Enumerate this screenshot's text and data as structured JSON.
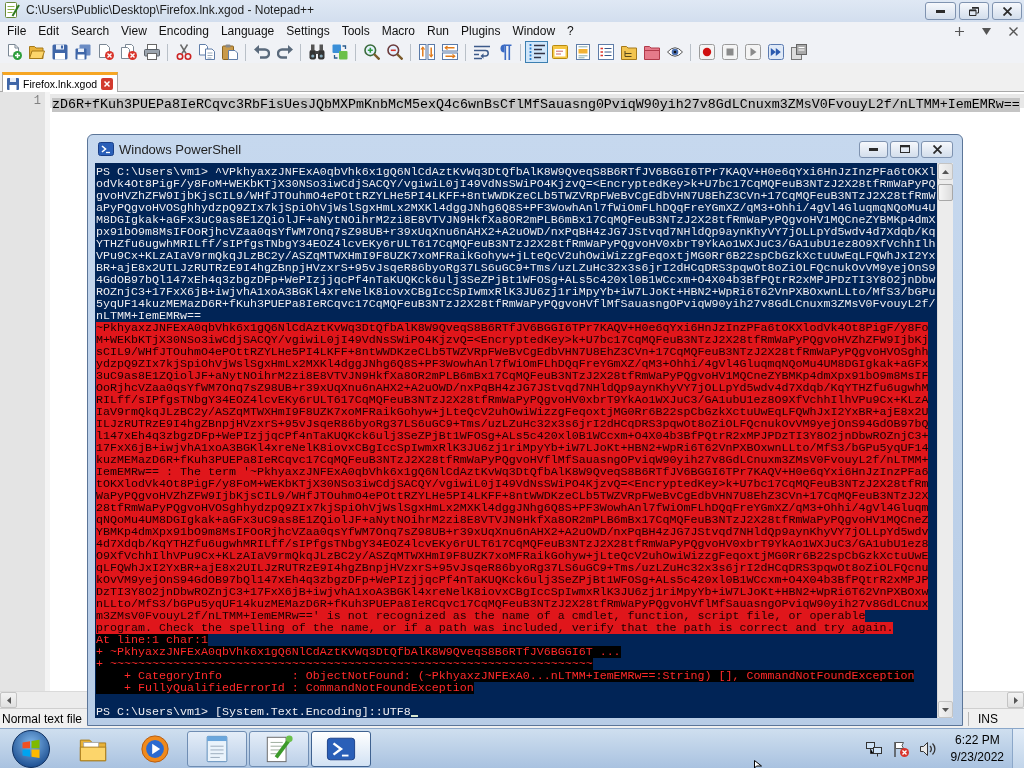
{
  "notepad": {
    "title": "C:\\Users\\Public\\Desktop\\Firefox.lnk.xgod - Notepad++",
    "menu": [
      "File",
      "Edit",
      "Search",
      "View",
      "Encoding",
      "Language",
      "Settings",
      "Tools",
      "Macro",
      "Run",
      "Plugins",
      "Window",
      "?"
    ],
    "toolbar": [
      {
        "pressed": false
      },
      {
        "pressed": false
      },
      {
        "pressed": false
      },
      {
        "pressed": false
      },
      {
        "pressed": false
      },
      {
        "pressed": false
      },
      {
        "pressed": false
      },
      {
        "pressed": false
      },
      {
        "pressed": false
      },
      {
        "pressed": false
      },
      {
        "pressed": false
      },
      {
        "pressed": false
      },
      {
        "pressed": false
      },
      {
        "pressed": false
      },
      {
        "pressed": false
      },
      {
        "pressed": false
      },
      {
        "pressed": false
      },
      {
        "pressed": false
      },
      {
        "pressed": false
      },
      {
        "pressed": false
      },
      {
        "pressed": true
      },
      {
        "pressed": false
      },
      {
        "pressed": false
      },
      {
        "pressed": false
      },
      {
        "pressed": false
      },
      {
        "pressed": false
      },
      {
        "pressed": false
      },
      {
        "pressed": false
      },
      {
        "pressed": false
      },
      {
        "pressed": false
      },
      {
        "pressed": false
      },
      {
        "pressed": false
      }
    ],
    "tabs": [
      {
        "label": "Firefox.lnk.xgod",
        "selected": true
      }
    ],
    "editor": {
      "lines": [
        {
          "number": "1",
          "text": "zD6R+fKuh3PUEPa8IeRCqvc3RbFisUesJQbMXPmKnbMcM5exQ4c6wnBsCflMfSauasng0PviqW90yih27v8GdLCnuxm3ZMsV0FvouyL2f/nLTMM+IemEMRw==",
          "selected": true
        }
      ]
    },
    "status_bar": {
      "file_type": "Normal text file",
      "mode": "INS"
    }
  },
  "powershell": {
    "title": "Windows PowerShell",
    "lines": [
      {
        "kind": "input",
        "text": "PS C:\\Users\\vm1> ^VPkhyaxzJNFExA0qbVhk6x1gQ6NlCdAztKvWq3DtQfbAlK8W9QveqS8B6RTfJV6BGGI6TPr7KAQV+H0e6qYxi6HnJzInzPFa6tOKXl"
      },
      {
        "kind": "input",
        "text": "odVk4Ot8PigF/y8FoM+WEKbKTjX30NSo3iwCdjSACQY/vgiwiL0jI49VdNsSWiPO4KjzvQ=<EncryptedKey>k+U7bc17CqMQFeuB3NTzJ2X28tfRmWaPyPQ"
      },
      {
        "kind": "input",
        "text": "gvoHVZhZFW9IjbKjsCIL9/WHfJTOuhmO4ePOttRZYLHe5PI4LKFF+8ntWWDKzeCLb5TWZVRpFWeBvCgEdbVHN7U8EhZ3CVn+17CqMQFeuB3NTzJ2X28tfRmW"
      },
      {
        "kind": "input",
        "text": "aPyPQgvoHVOSghhydzpQ9ZIx7kjSpiOhVjWslSgxHmLx2MXKl4dggJNhg6Q8S+PF3WowhAnl7fWiOmFLhDQqFreYGmXZ/qM3+Ohhi/4gVl4GluqmqNQoMu4U"
      },
      {
        "kind": "input",
        "text": "M8DGIgkak+aGFx3uC9as8E1ZQiolJF+aNytNOihrM2zi8E8VTVJN9HkfXa8OR2mPLB6mBx17CqMQFeuB3NTzJ2X28tfRmWaPyPQgvoHV1MQCneZYBMKp4dmX"
      },
      {
        "kind": "input",
        "text": "px91bO9m8MsIFOoRjhcVZaa0qsYfWM7Onq7sZ98UB+r39xUqXnu6nAHX2+A2uOWD/nxPqBH4zJG7JStvqd7NHldQp9aynKhyVY7jOLLpYd5wdv4d7Xdqb/Kq"
      },
      {
        "kind": "input",
        "text": "YTHZfu6ugwhMRILff/sIPfgsTNbgY34EOZ4lcvEKy6rULT617CqMQFeuB3NTzJ2X28tfRmWaPyPQgvoHV0xbrT9YkAo1WXJuC3/GA1ubU1ez8O9XfVchhIlh"
      },
      {
        "kind": "input",
        "text": "VPu9Cx+KLzAIaV9rmQkqJLzBC2y/ASZqMTWXHmI9F8UZK7xoMFRaikGohyw+jLteQcV2uhOwiWizzgFeqoxtjMG0Rr6B22spCbGzkXctuUwEqLFQWhJxI2Yx"
      },
      {
        "kind": "input",
        "text": "BR+ajE8x2UILJzRUTRzE9I4hgZBnpjHVzxrS+95vJsqeR86byoRg37LS6uGC9+Tms/uzLZuHc32x3s6jrI2dHCqDRS3pqwOt8oZiOLFQcnukOvVM9yejOnS9"
      },
      {
        "kind": "input",
        "text": "4GdOB97bQl147xEh4q3zbgzDFp+WePIzjjqcPf4nTaKUQKck6ulj3SeZPjBt1WFOSg+ALs5c420xl0B1WCcxm+O4X04b3BfPQtrR2xMPJPDzTI3Y8O2jnDbw"
      },
      {
        "kind": "input",
        "text": "ROZnjC3+17FxX6jB+iwjvhA1xoA3BGKl4xreNelK8iovxCBgIccSpIwmxRlK3JU6zj1riMpyYb+iW7LJoKt+HBN2+WpRi6T62VnPXBOxwnLLto/MfS3/bGPu"
      },
      {
        "kind": "input",
        "text": "5yqUF14kuzMEMazD6R+fKuh3PUEPa8IeRCqvc17CqMQFeuB3NTzJ2X28tfRmWaPyPQgvoHVflMfSauasngOPviqW90yih27v8GdLCnuxm3ZMsV0FvouyL2f/"
      },
      {
        "kind": "input",
        "text": "nLTMM+IemEMRw=="
      },
      {
        "kind": "error-marked",
        "text": "~PkhyaxzJNFExA0qbVhk6x1gQ6NlCdAztKvWq3DtQfbAlK8W9QveqS8B6RTfJV6BGGI6TPr7KAQV+H0e6qYxi6HnJzInzPFa6tOKXlodVk4Ot8PigF/y8Fo"
      },
      {
        "kind": "error-marked",
        "text": "M+WEKbKTjX30NSo3iwCdjSACQY/vgiwiL0jI49VdNsSWiPO4KjzvQ=<EncryptedKey>k+U7bc17CqMQFeuB3NTzJ2X28tfRmWaPyPQgvoHVZhZFW9IjbKj"
      },
      {
        "kind": "error-marked",
        "text": "sCIL9/WHfJTOuhmO4ePOttRZYLHe5PI4LKFF+8ntWWDKzeCLb5TWZVRpFWeBvCgEdbVHN7U8EhZ3CVn+17CqMQFeuB3NTzJ2X28tfRmWaPyPQgvoHVOSghh"
      },
      {
        "kind": "error-marked",
        "text": "ydzpQ9ZIx7kjSpiOhVjWslSgxHmLx2MXKl4dggJNhg6Q8S+PF3WowhAnl7fWiOmFLhDQqFreYGmXZ/qM3+Ohhi/4gVl4GluqmqNQoMu4UM8DGIgkak+aGFx"
      },
      {
        "kind": "error-marked",
        "text": "3uC9as8E1ZQiolJF+aNytNOihrM2zi8E8VTVJN9HkfXa8OR2mPLB6mBx17CqMQFeuB3NTzJ2X28tfRmWaPyPQgvoHV1MQCneZYBMKp4dmXpx91bO9m8MsIF"
      },
      {
        "kind": "error-marked",
        "text": "OoRjhcVZaa0qsYfWM7Onq7sZ98UB+r39xUqXnu6nAHX2+A2uOWD/nxPqBH4zJG7JStvqd7NHldQp9aynKhyVY7jOLLpYd5wdv4d7Xdqb/KqYTHZfu6ugwhM"
      },
      {
        "kind": "error-marked",
        "text": "RILff/sIPfgsTNbgY34EOZ4lcvEKy6rULT617CqMQFeuB3NTzJ2X28tfRmWaPyPQgvoHV0xbrT9YkAo1WXJuC3/GA1ubU1ez8O9XfVchhIlhVPu9Cx+KLzA"
      },
      {
        "kind": "error-marked",
        "text": "IaV9rmQkqJLzBC2y/ASZqMTWXHmI9F8UZK7xoMFRaikGohyw+jLteQcV2uhOwiWizzgFeqoxtjMG0Rr6B22spCbGzkXctuUwEqLFQWhJxI2YxBR+ajE8x2U"
      },
      {
        "kind": "error-marked",
        "text": "ILJzRUTRzE9I4hgZBnpjHVzxrS+95vJsqeR86byoRg37LS6uGC9+Tms/uzLZuHc32x3s6jrI2dHCqDRS3pqwOt8oZiOLFQcnukOvVM9yejOnS94GdOB97bQ"
      },
      {
        "kind": "error-marked",
        "text": "l147xEh4q3zbgzDFp+WePIzjjqcPf4nTaKUQKck6ulj3SeZPjBt1WFOSg+ALs5c420xl0B1WCcxm+O4X04b3BfPQtrR2xMPJPDzTI3Y8O2jnDbwROZnjC3+"
      },
      {
        "kind": "error-marked",
        "text": "17FxX6jB+iwjvhA1xoA3BGKl4xreNelK8iovxCBgIccSpIwmxRlK3JU6zj1riMpyYb+iW7LJoKt+HBN2+WpRi6T62VnPXBOxwnLLto/MfS3/bGPu5yqUF14"
      },
      {
        "kind": "error-marked",
        "text": "kuzMEMazD6R+fKuh3PUEPa8IeRCqvc17CqMQFeuB3NTzJ2X28tfRmWaPyPQgvoHVflMfSauasngOPviqW90yih27v8GdLCnuxm3ZMsV0FvouyL2f/nLTMM+"
      },
      {
        "kind": "error-marked",
        "text": "IemEMRw== : The term '~PkhyaxzJNFExA0qbVhk6x1gQ6NlCdAztKvWq3DtQfbAlK8W9QveqS8B6RTfJV6BGGI6TPr7KAQV+H0e6qYxi6HnJzInzPFa6"
      },
      {
        "kind": "error-marked",
        "text": "tOKXlodVk4Ot8PigF/y8FoM+WEKbKTjX30NSo3iwCdjSACQY/vgiwiL0jI49VdNsSWiPO4KjzvQ=<EncryptedKey>k+U7bc17CqMQFeuB3NTzJ2X28tfRm"
      },
      {
        "kind": "error-marked",
        "text": "WaPyPQgvoHVZhZFW9IjbKjsCIL9/WHfJTOuhmO4ePOttRZYLHe5PI4LKFF+8ntWWDKzeCLb5TWZVRpFWeBvCgEdbVHN7U8EhZ3CVn+17CqMQFeuB3NTzJ2X"
      },
      {
        "kind": "error-marked",
        "text": "28tfRmWaPyPQgvoHVOSghhydzpQ9ZIx7kjSpiOhVjWslSgxHmLx2MXKl4dggJNhg6Q8S+PF3WowhAnl7fWiOmFLhDQqFreYGmXZ/qM3+Ohhi/4gVl4Gluqm"
      },
      {
        "kind": "error-marked",
        "text": "qNQoMu4UM8DGIgkak+aGFx3uC9as8E1ZQiolJF+aNytNOihrM2zi8E8VTVJN9HkfXa8OR2mPLB6mBx17CqMQFeuB3NTzJ2X28tfRmWaPyPQgvoHV1MQCneZ"
      },
      {
        "kind": "error-marked",
        "text": "YBMKp4dmXpx91bO9m8MsIFOoRjhcVZaa0qsYfWM7Onq7sZ98UB+r39xUqXnu6nAHX2+A2uOWD/nxPqBH4zJG7JStvqd7NHldQp9aynKhyVY7jOLLpYd5wdv"
      },
      {
        "kind": "error-marked",
        "text": "4d7Xdqb/KqYTHZfu6ugwhMRILff/sIPfgsTNbgY34EOZ4lcvEKy6rULT617CqMQFeuB3NTzJ2X28tfRmWaPyPQgvoHV0xbrT9YkAo1WXJuC3/GA1ubU1ez8"
      },
      {
        "kind": "error-marked",
        "text": "O9XfVchhIlhVPu9Cx+KLzAIaV9rmQkqJLzBC2y/ASZqMTWXHmI9F8UZK7xoMFRaikGohyw+jLteQcV2uhOwiWizzgFeqoxtjMG0Rr6B22spCbGzkXctuUwE"
      },
      {
        "kind": "error-marked",
        "text": "qLFQWhJxI2YxBR+ajE8x2UILJzRUTRzE9I4hgZBnpjHVzxrS+95vJsqeR86byoRg37LS6uGC9+Tms/uzLZuHc32x3s6jrI2dHCqDRS3pqwOt8oZiOLFQcnu"
      },
      {
        "kind": "error-marked",
        "text": "kOvVM9yejOnS94GdOB97bQl147xEh4q3zbgzDFp+WePIzjjqcPf4nTaKUQKck6ulj3SeZPjBt1WFOSg+ALs5c420xl0B1WCcxm+O4X04b3BfPQtrR2xMPJP"
      },
      {
        "kind": "error-marked",
        "text": "DzTI3Y8O2jnDbwROZnjC3+17FxX6jB+iwjvhA1xoA3BGKl4xreNelK8iovxCBgIccSpIwmxRlK3JU6zj1riMpyYb+iW7LJoKt+HBN2+WpRi6T62VnPXBOxw"
      },
      {
        "kind": "error-marked",
        "text": "nLLto/MfS3/bGPu5yqUF14kuzMEMazD6R+fKuh3PUEPa8IeRCqvc17CqMQFeuB3NTzJ2X28tfRmWaPyPQgvoHVflMfSauasngOPviqW90yih27v8GdLCnux"
      },
      {
        "kind": "error-marked",
        "text": "m3ZMsV0FvouyL2f/nLTMM+IemEMRw==' is not recognized as the name of a cmdlet, function, script file, or operable"
      },
      {
        "kind": "error-marked",
        "text": "program. Check the spelling of the name, or if a path was included, verify that the path is correct and try again."
      },
      {
        "kind": "error",
        "text": "At line:1 char:1"
      },
      {
        "kind": "error",
        "text": "+ ~PkhyaxzJNFExA0qbVhk6x1gQ6NlCdAztKvWq3DtQfbAlK8W9QveqS8B6RTfJV6BGGI6T ..."
      },
      {
        "kind": "error",
        "text": "+ ~~~~~~~~~~~~~~~~~~~~~~~~~~~~~~~~~~~~~~~~~~~~~~~~~~~~~~~~~~~~~~~~~~~~~"
      },
      {
        "kind": "error",
        "text": "    + CategoryInfo          : ObjectNotFound: (~PkhyaxzJNFExA0...nLTMM+IemEMRw==:String) [], CommandNotFoundException"
      },
      {
        "kind": "error",
        "text": "    + FullyQualifiedErrorId : CommandNotFoundException"
      }
    ],
    "prompt": "PS C:\\Users\\vm1> [System.Text.Encoding]::UTF8"
  },
  "taskbar": {
    "apps": [
      {
        "running": false,
        "selected": false
      },
      {
        "running": false,
        "selected": false
      },
      {
        "running": true,
        "selected": false
      },
      {
        "running": true,
        "selected": false
      },
      {
        "running": true,
        "selected": true
      }
    ],
    "clock": {
      "time": "6:22 PM",
      "date": "9/23/2022"
    }
  }
}
